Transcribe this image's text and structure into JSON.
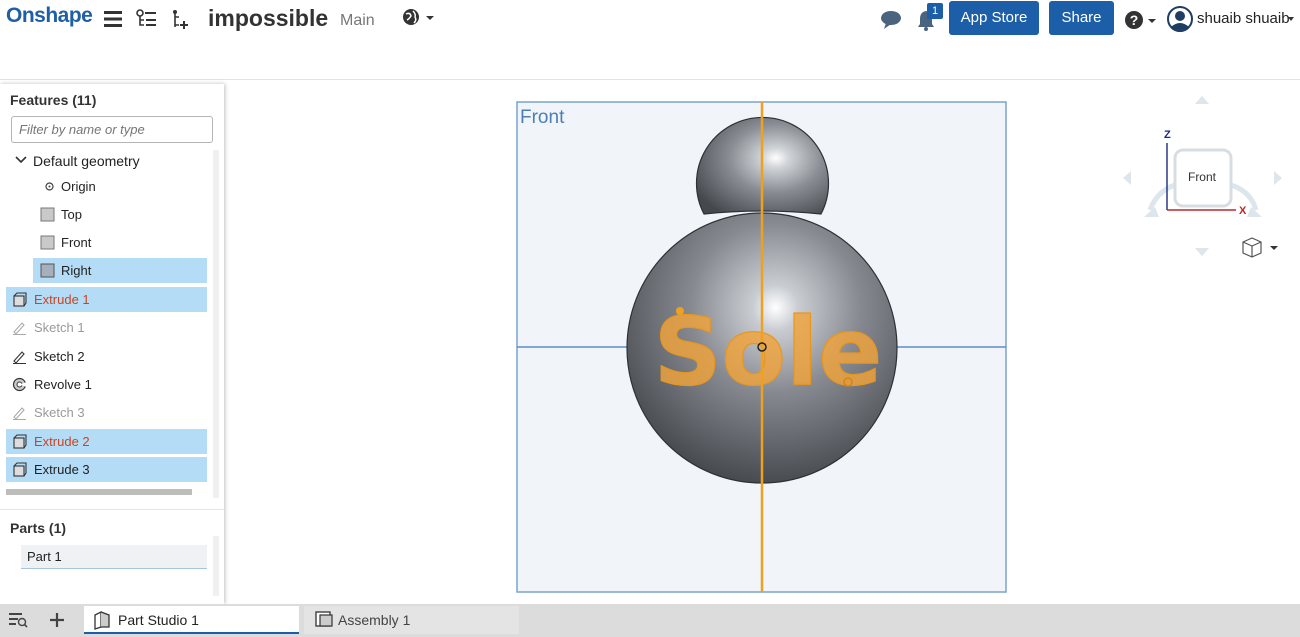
{
  "app": {
    "logo": "Onshape",
    "document_name": "impossible",
    "branch": "Main",
    "notification_count": "1",
    "app_store_label": "App Store",
    "share_label": "Share",
    "user_name": "shuaib shuaib",
    "accent_color": "#1d5ea8"
  },
  "features": {
    "title": "Features (11)",
    "filter_placeholder": "Filter by name or type",
    "group_label": "Default geometry",
    "items": [
      {
        "label": "Origin"
      },
      {
        "label": "Top"
      },
      {
        "label": "Front"
      },
      {
        "label": "Right"
      },
      {
        "label": "Extrude 1"
      },
      {
        "label": "Sketch 1"
      },
      {
        "label": "Sketch 2"
      },
      {
        "label": "Revolve 1"
      },
      {
        "label": "Sketch 3"
      },
      {
        "label": "Extrude 2"
      },
      {
        "label": "Extrude 3"
      }
    ]
  },
  "parts": {
    "title": "Parts (1)",
    "items": [
      {
        "label": "Part 1"
      }
    ]
  },
  "viewport": {
    "plane_label": "Front",
    "sketch_text": "Sole",
    "view_cube_label": "Front",
    "axis_z": "Z",
    "axis_x": "X"
  },
  "tabs": [
    {
      "label": "Part Studio 1"
    },
    {
      "label": "Assembly 1"
    }
  ]
}
